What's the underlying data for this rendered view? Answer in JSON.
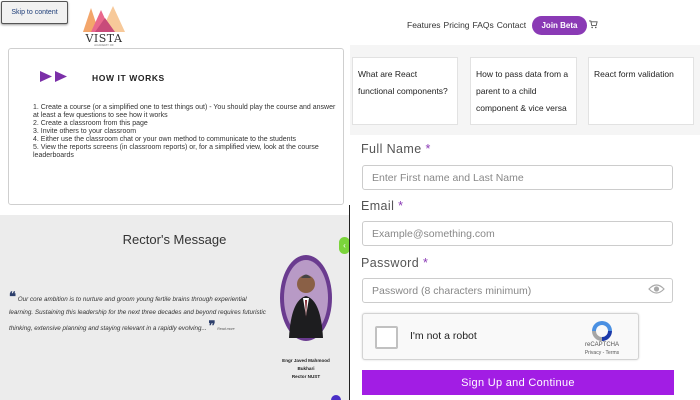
{
  "header": {
    "skip_link": "Skip to content",
    "logo_text": "VISTA",
    "logo_subtext": "ACADEMY OF TECHNOLOGY",
    "nav": [
      "Features",
      "Pricing",
      "FAQs",
      "Contact"
    ],
    "join_button": "Join Beta",
    "cart_icon": "cart-icon"
  },
  "how_it_works": {
    "title": "HOW IT WORKS",
    "steps": [
      "1. Create a course (or a simplified one to test things out) - You should play the course and answer at least a few questions to see how it works",
      "2. Create a classroom from this page",
      "3. Invite others to your classroom",
      "4. Either use the classroom chat or your own method to communicate to the students",
      "5. View the reports screens (in classroom reports) or, for a simplified view, look at the course leaderboards"
    ]
  },
  "rector": {
    "title": "Rector's Message",
    "quote": "Our core ambition is to nurture and groom young fertile brains through experiential learning. Sustaining this leadership for the next three decades and beyond requires futuristic thinking, extensive planning and staying relevant in a rapidly evolving...",
    "sign": "Read more",
    "name_line1": "Engr Javed Mahmood Bukhari",
    "name_line2": "Rector NUST"
  },
  "related_cards": [
    "What are React functional components?",
    "How to pass data from a parent to a child component & vice versa",
    "React form validation"
  ],
  "form": {
    "full_name_label": "Full Name",
    "full_name_placeholder": "Enter First name and Last Name",
    "email_label": "Email",
    "email_placeholder": "Example@something.com",
    "password_label": "Password",
    "password_placeholder": "Password (8 characters minimum)",
    "required_mark": "*",
    "captcha_label": "I'm not a robot",
    "captcha_brand": "reCAPTCHA",
    "captcha_links": "Privacy - Terms",
    "submit_label": "Sign Up and Continue"
  },
  "colors": {
    "accent": "#8a3ab5",
    "submit": "#a21de4",
    "quote_mark": "#2d3f6c"
  }
}
